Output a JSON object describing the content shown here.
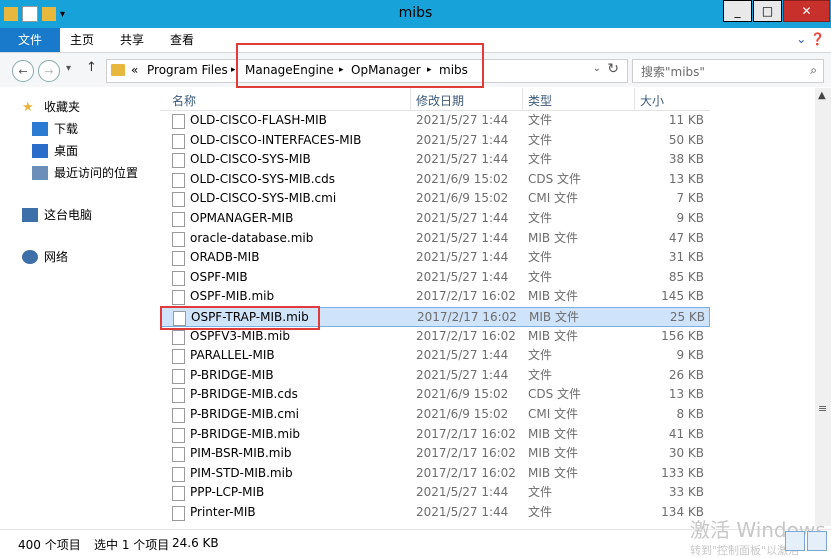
{
  "window": {
    "title": "mibs"
  },
  "titlebar_buttons": [
    "_",
    "□",
    "✕"
  ],
  "ribbon": {
    "tabs": [
      "文件",
      "主页",
      "共享",
      "查看"
    ]
  },
  "address": {
    "overflow": "«",
    "crumbs": [
      "Program Files",
      "ManageEngine",
      "OpManager",
      "mibs"
    ],
    "separator": "▸"
  },
  "search": {
    "placeholder": "搜索\"mibs\""
  },
  "nav": {
    "favorites": "收藏夹",
    "downloads": "下载",
    "desktop": "桌面",
    "recent": "最近访问的位置",
    "this_pc": "这台电脑",
    "network": "网络"
  },
  "columns": {
    "name": "名称",
    "modified": "修改日期",
    "type": "类型",
    "size": "大小"
  },
  "files": [
    {
      "name": "OLD-CISCO-FLASH-MIB",
      "date": "2021/5/27 1:44",
      "type": "文件",
      "size": "11 KB"
    },
    {
      "name": "OLD-CISCO-INTERFACES-MIB",
      "date": "2021/5/27 1:44",
      "type": "文件",
      "size": "50 KB"
    },
    {
      "name": "OLD-CISCO-SYS-MIB",
      "date": "2021/5/27 1:44",
      "type": "文件",
      "size": "38 KB"
    },
    {
      "name": "OLD-CISCO-SYS-MIB.cds",
      "date": "2021/6/9 15:02",
      "type": "CDS 文件",
      "size": "13 KB"
    },
    {
      "name": "OLD-CISCO-SYS-MIB.cmi",
      "date": "2021/6/9 15:02",
      "type": "CMI 文件",
      "size": "7 KB"
    },
    {
      "name": "OPMANAGER-MIB",
      "date": "2021/5/27 1:44",
      "type": "文件",
      "size": "9 KB"
    },
    {
      "name": "oracle-database.mib",
      "date": "2021/5/27 1:44",
      "type": "MIB 文件",
      "size": "47 KB"
    },
    {
      "name": "ORADB-MIB",
      "date": "2021/5/27 1:44",
      "type": "文件",
      "size": "31 KB"
    },
    {
      "name": "OSPF-MIB",
      "date": "2021/5/27 1:44",
      "type": "文件",
      "size": "85 KB"
    },
    {
      "name": "OSPF-MIB.mib",
      "date": "2017/2/17 16:02",
      "type": "MIB 文件",
      "size": "145 KB"
    },
    {
      "name": "OSPF-TRAP-MIB.mib",
      "date": "2017/2/17 16:02",
      "type": "MIB 文件",
      "size": "25 KB",
      "selected": true
    },
    {
      "name": "OSPFV3-MIB.mib",
      "date": "2017/2/17 16:02",
      "type": "MIB 文件",
      "size": "156 KB"
    },
    {
      "name": "PARALLEL-MIB",
      "date": "2021/5/27 1:44",
      "type": "文件",
      "size": "9 KB"
    },
    {
      "name": "P-BRIDGE-MIB",
      "date": "2021/5/27 1:44",
      "type": "文件",
      "size": "26 KB"
    },
    {
      "name": "P-BRIDGE-MIB.cds",
      "date": "2021/6/9 15:02",
      "type": "CDS 文件",
      "size": "13 KB"
    },
    {
      "name": "P-BRIDGE-MIB.cmi",
      "date": "2021/6/9 15:02",
      "type": "CMI 文件",
      "size": "8 KB"
    },
    {
      "name": "P-BRIDGE-MIB.mib",
      "date": "2017/2/17 16:02",
      "type": "MIB 文件",
      "size": "41 KB"
    },
    {
      "name": "PIM-BSR-MIB.mib",
      "date": "2017/2/17 16:02",
      "type": "MIB 文件",
      "size": "30 KB"
    },
    {
      "name": "PIM-STD-MIB.mib",
      "date": "2017/2/17 16:02",
      "type": "MIB 文件",
      "size": "133 KB"
    },
    {
      "name": "PPP-LCP-MIB",
      "date": "2021/5/27 1:44",
      "type": "文件",
      "size": "33 KB"
    },
    {
      "name": "Printer-MIB",
      "date": "2021/5/27 1:44",
      "type": "文件",
      "size": "134 KB"
    }
  ],
  "status": {
    "count": "400 个项目",
    "selected": "选中 1 个项目",
    "size": "24.6 KB"
  },
  "watermark": {
    "line1": "激活 Windows",
    "line2": "转到\"控制面板\"以激活"
  },
  "colors": {
    "titlebar": "#17a2d9",
    "file_tab": "#1979ca",
    "highlight": "#e03a3a",
    "selection": "#cfe3fa"
  }
}
